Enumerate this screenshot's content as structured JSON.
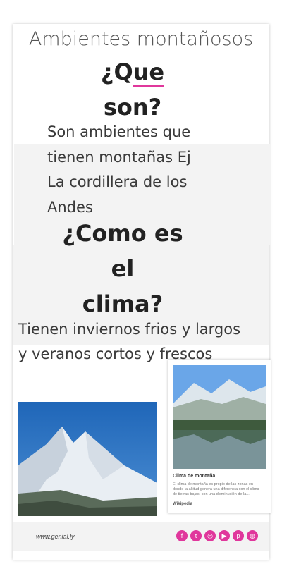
{
  "title": "Ambientes montañosos",
  "question1": {
    "line1": "¿Que",
    "line2": "son?"
  },
  "answer1": [
    "Son ambientes que",
    "tienen montañas  Ej",
    "La cordillera de los",
    "Andes"
  ],
  "question2": {
    "line1": "¿Como es",
    "line2": "el",
    "line3": "clima?"
  },
  "answer2": [
    "Tienen inviernos frios y largos",
    "y veranos cortos y frescos"
  ],
  "wiki_card": {
    "title": "Clima de montaña",
    "description": "El clima de montaña es propio de las zonas en donde la altitud genera una diferencia con el clima de tierras bajas, con una disminución de la...",
    "source": "Wikipedia"
  },
  "footer": {
    "brand": "www.genial.ly",
    "social_icons": [
      "facebook-icon",
      "twitter-icon",
      "instagram-icon",
      "youtube-icon",
      "pinterest-icon",
      "dribbble-icon"
    ]
  },
  "colors": {
    "accent": "#e0379c",
    "band": "#f3f3f3",
    "text": "#333333"
  }
}
